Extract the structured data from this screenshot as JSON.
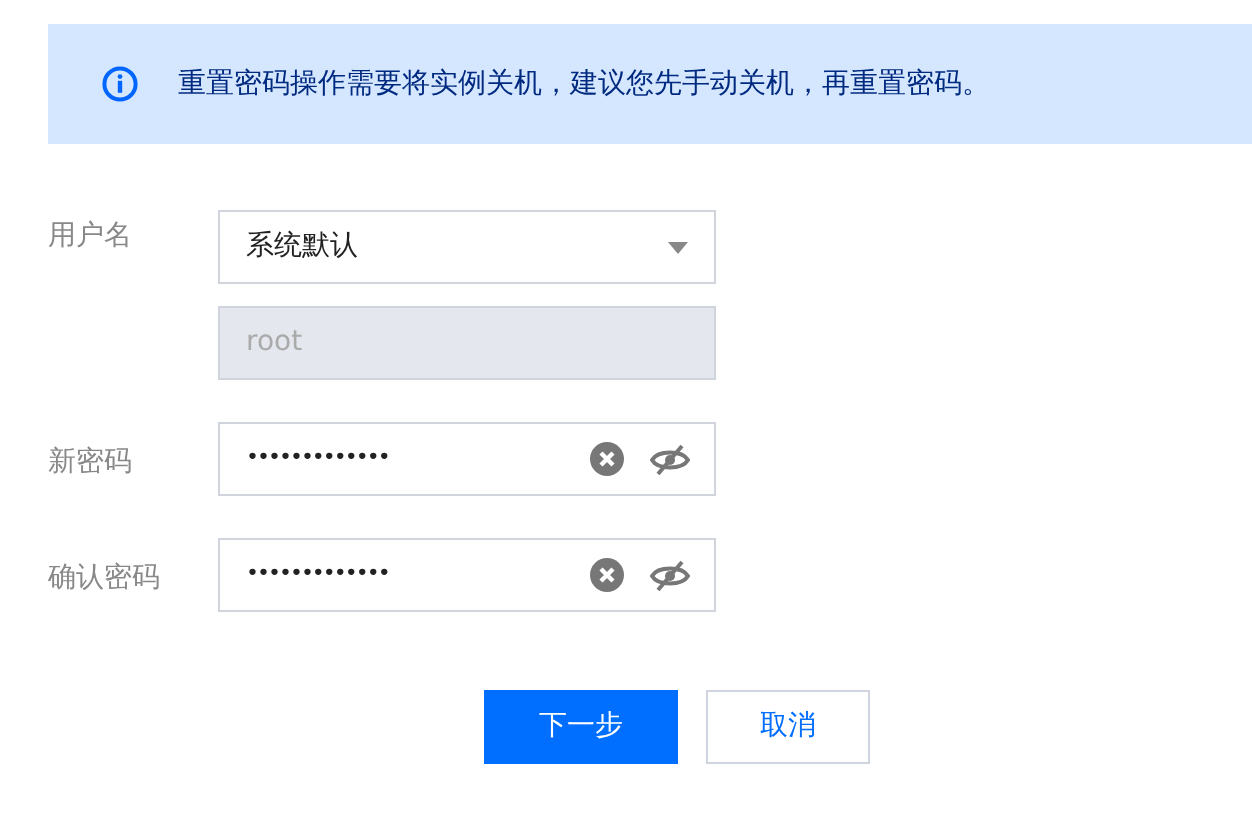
{
  "alert": {
    "text": "重置密码操作需要将实例关机，建议您先手动关机，再重置密码。"
  },
  "fields": [
    {
      "label": "用户名",
      "kind": "select",
      "value": "系统默认"
    },
    {
      "kind": "readonly",
      "value": "root"
    },
    {
      "label": "新密码",
      "kind": "password",
      "value": "•••••••••••••"
    },
    {
      "label": "确认密码",
      "kind": "password",
      "value": "•••••••••••••"
    }
  ],
  "buttons": [
    {
      "label": "下一步",
      "kind": "primary"
    },
    {
      "label": "取消",
      "kind": "secondary"
    }
  ]
}
